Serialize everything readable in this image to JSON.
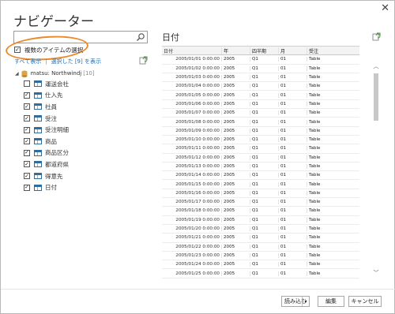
{
  "dialog": {
    "title": "ナビゲーター",
    "close_glyph": "✕"
  },
  "left_pane": {
    "search": {
      "value": "",
      "placeholder": ""
    },
    "multi_select": {
      "label": "複数のアイテムの選択",
      "checked": true
    },
    "links": {
      "show_all": "すべて表示",
      "separator": "|",
      "show_selected": "選択した [9] を表示"
    },
    "tree": {
      "root": {
        "label": "matsu: Northwindj",
        "count": "[10]"
      },
      "items": [
        {
          "label": "運送会社",
          "checked": false
        },
        {
          "label": "仕入先",
          "checked": true
        },
        {
          "label": "社員",
          "checked": true
        },
        {
          "label": "受注",
          "checked": true
        },
        {
          "label": "受注明細",
          "checked": true
        },
        {
          "label": "商品",
          "checked": true
        },
        {
          "label": "商品区分",
          "checked": true
        },
        {
          "label": "都道府県",
          "checked": true
        },
        {
          "label": "得意先",
          "checked": true
        },
        {
          "label": "日付",
          "checked": true
        }
      ]
    }
  },
  "right_pane": {
    "title": "日付",
    "table": {
      "columns": [
        "日付",
        "年",
        "四半期",
        "月",
        "受注"
      ],
      "rows": [
        [
          "2005/01/01 0:00:00",
          "2005",
          "Q1",
          "01",
          "Table"
        ],
        [
          "2005/01/02 0:00:00",
          "2005",
          "Q1",
          "01",
          "Table"
        ],
        [
          "2005/01/03 0:00:00",
          "2005",
          "Q1",
          "01",
          "Table"
        ],
        [
          "2005/01/04 0:00:00",
          "2005",
          "Q1",
          "01",
          "Table"
        ],
        [
          "2005/01/05 0:00:00",
          "2005",
          "Q1",
          "01",
          "Table"
        ],
        [
          "2005/01/06 0:00:00",
          "2005",
          "Q1",
          "01",
          "Table"
        ],
        [
          "2005/01/07 0:00:00",
          "2005",
          "Q1",
          "01",
          "Table"
        ],
        [
          "2005/01/08 0:00:00",
          "2005",
          "Q1",
          "01",
          "Table"
        ],
        [
          "2005/01/09 0:00:00",
          "2005",
          "Q1",
          "01",
          "Table"
        ],
        [
          "2005/01/10 0:00:00",
          "2005",
          "Q1",
          "01",
          "Table"
        ],
        [
          "2005/01/11 0:00:00",
          "2005",
          "Q1",
          "01",
          "Table"
        ],
        [
          "2005/01/12 0:00:00",
          "2005",
          "Q1",
          "01",
          "Table"
        ],
        [
          "2005/01/13 0:00:00",
          "2005",
          "Q1",
          "01",
          "Table"
        ],
        [
          "2005/01/14 0:00:00",
          "2005",
          "Q1",
          "01",
          "Table"
        ],
        [
          "2005/01/15 0:00:00",
          "2005",
          "Q1",
          "01",
          "Table"
        ],
        [
          "2005/01/16 0:00:00",
          "2005",
          "Q1",
          "01",
          "Table"
        ],
        [
          "2005/01/17 0:00:00",
          "2005",
          "Q1",
          "01",
          "Table"
        ],
        [
          "2005/01/18 0:00:00",
          "2005",
          "Q1",
          "01",
          "Table"
        ],
        [
          "2005/01/19 0:00:00",
          "2005",
          "Q1",
          "01",
          "Table"
        ],
        [
          "2005/01/20 0:00:00",
          "2005",
          "Q1",
          "01",
          "Table"
        ],
        [
          "2005/01/21 0:00:00",
          "2005",
          "Q1",
          "01",
          "Table"
        ],
        [
          "2005/01/22 0:00:00",
          "2005",
          "Q1",
          "01",
          "Table"
        ],
        [
          "2005/01/23 0:00:00",
          "2005",
          "Q1",
          "01",
          "Table"
        ],
        [
          "2005/01/24 0:00:00",
          "2005",
          "Q1",
          "01",
          "Table"
        ],
        [
          "2005/01/25 0:00:00",
          "2005",
          "Q1",
          "01",
          "Table"
        ]
      ]
    }
  },
  "footer": {
    "load_label": "読み込む",
    "load_dropdown_glyph": "▾",
    "edit_label": "編集",
    "cancel_label": "キャンセル"
  },
  "colors": {
    "annotation": "#ea8a2a",
    "link": "#1f6fb5",
    "table_icon": "#2e6d9e"
  }
}
